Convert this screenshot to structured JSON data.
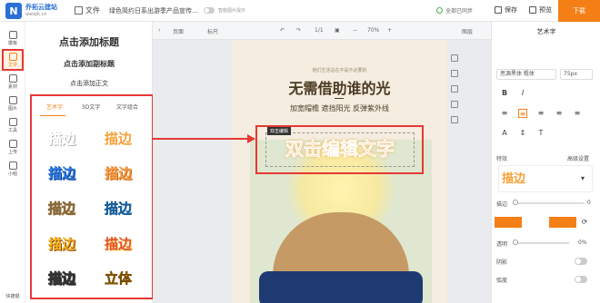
{
  "brand": {
    "name": "乔拓云建站",
    "url": "weiqik.cn"
  },
  "topbar": {
    "file_label": "文件",
    "doc_title": "绿色简约日系出游季产品宣传...",
    "smart_label": "智能图片提示",
    "saved_label": "全部已同步",
    "save_label": "保存",
    "preview_label": "预览",
    "download_label": "下载"
  },
  "leftbar": {
    "items": [
      "模板",
      "文字",
      "素材",
      "图片",
      "工具",
      "上传",
      "小组"
    ],
    "bottom": "快捷键"
  },
  "panel": {
    "add_title": "点击添加标题",
    "add_subtitle": "点击添加副标题",
    "add_body": "点击添加正文",
    "tabs": [
      "艺术字",
      "3D文字",
      "文字组合"
    ],
    "samples": [
      "描边",
      "描边",
      "描边",
      "描边",
      "描边",
      "描边",
      "描边",
      "描边",
      "描边",
      "立体"
    ]
  },
  "canvas_toolbar": {
    "page_label": "页面",
    "ruler_label": "标尺",
    "page_count": "1/1",
    "zoom": "70%",
    "layer_label": "图层"
  },
  "poster": {
    "subhead": "她们生活总在不是不必要的",
    "headline": "无需借助谁的光",
    "tagline": "加宽帽檐 遮挡阳光 反弹紫外线",
    "selection_label": "双击编辑",
    "edit_text": "双击编辑文字"
  },
  "props": {
    "title": "艺术字",
    "font": "思源黑体 粗体",
    "size": "75px",
    "effects_label": "特效",
    "advanced_label": "高级设置",
    "effect_preview": "描边",
    "stroke_label": "描边",
    "stroke_value": "0",
    "opacity_label": "透明",
    "opacity_value": "0%",
    "shadow_label": "阴影",
    "curve_label": "弧度",
    "accent": "#f57f17"
  }
}
